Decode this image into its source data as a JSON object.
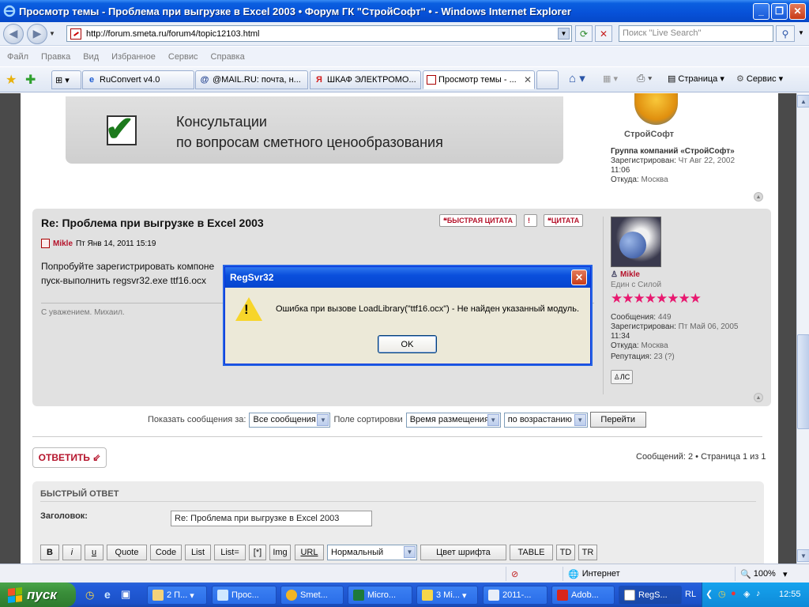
{
  "window": {
    "title": "Просмотр темы - Проблема при выгрузке в Excel 2003 • Форум ГК \"СтройСофт\" • - Windows Internet Explorer",
    "min": "_",
    "max": "❐",
    "close": "✕"
  },
  "address": {
    "url": "http://forum.smeta.ru/forum4/topic12103.html",
    "search_placeholder": "Поиск \"Live Search\""
  },
  "menu": [
    "Файл",
    "Правка",
    "Вид",
    "Избранное",
    "Сервис",
    "Справка"
  ],
  "tabs": [
    {
      "label": "RuConvert v4.0",
      "icon": "ie-icon"
    },
    {
      "label": "@MAIL.RU: почта, н...",
      "icon": "at-icon"
    },
    {
      "label": "ШКАФ ЭЛЕКТРОМО...",
      "icon": "yandex-icon"
    },
    {
      "label": "Просмотр темы - ...",
      "icon": "page-icon",
      "active": true
    }
  ],
  "commands": {
    "page": "Страница",
    "tools": "Сервис"
  },
  "banner": {
    "line1": "Консультации",
    "line2": "по вопросам сметного ценообразования"
  },
  "profile_top": {
    "brand": "СтройСофт",
    "group": "Группа компаний «СтройСофт»",
    "registered_label": "Зарегистрирован:",
    "registered_value": "Чт Авг 22, 2002",
    "registered_time": "11:06",
    "from_label": "Откуда:",
    "from_value": "Москва"
  },
  "post": {
    "title": "Re: Проблема при выгрузке в Excel 2003",
    "quick_quote": "❝БЫСТРАЯ ЦИТАТА",
    "report": "!",
    "quote": "❝ЦИТАТА",
    "author": "Mikle",
    "date": "Пт Янв 14, 2011 15:19",
    "body_line1": "Попробуйте зарегистрировать компоне",
    "body_line2": "пуск-выполнить regsvr32.exe ttf16.ocx",
    "signature": "С уважением. Михаил."
  },
  "profile_post": {
    "username": "Mikle",
    "rank": "Един с Силой",
    "stars": "★★★★★★★★",
    "posts_label": "Сообщения:",
    "posts_value": "449",
    "registered_label": "Зарегистрирован:",
    "registered_value": "Пт Май 06, 2005",
    "registered_time": "11:34",
    "from_label": "Откуда:",
    "from_value": "Москва",
    "rep_label": "Репутация:",
    "rep_value": "23 (?)",
    "pm": "ЛС"
  },
  "filter": {
    "show_label": "Показать сообщения за:",
    "show_value": "Все сообщения",
    "sort_label": "Поле сортировки",
    "sort_value": "Время размещения",
    "order_value": "по возрастанию",
    "go": "Перейти"
  },
  "reply_button": "ОТВЕТИТЬ ⇙",
  "page_info": "Сообщений: 2 • Страница 1 из 1",
  "quick_reply": {
    "title": "БЫСТРЫЙ ОТВЕТ",
    "subject_label": "Заголовок:",
    "subject_value": "Re: Проблема при выгрузке в Excel 2003",
    "toolbar": [
      "B",
      "i",
      "u",
      "Quote",
      "Code",
      "List",
      "List=",
      "[*]",
      "Img",
      "URL"
    ],
    "font_size": "Нормальный",
    "font_color": "Цвет шрифта",
    "table": "TABLE",
    "td": "TD",
    "tr": "TR"
  },
  "dialog": {
    "title": "RegSvr32",
    "message": "Ошибка при вызове LoadLibrary(\"ttf16.ocx\")  - Не найден указанный модуль.",
    "ok": "OK"
  },
  "status": {
    "zone": "Интернет",
    "zoom": "100%"
  },
  "taskbar": {
    "start": "пуск",
    "tasks": [
      {
        "label": "2 П...",
        "icon": "folder-icon"
      },
      {
        "label": "Прос...",
        "icon": "ie-icon"
      },
      {
        "label": "Smet...",
        "icon": "smeta-icon"
      },
      {
        "label": "Micro...",
        "icon": "excel-icon"
      },
      {
        "label": "3 Mi...",
        "icon": "app-icon"
      },
      {
        "label": "2011-...",
        "icon": "word-icon"
      },
      {
        "label": "Adob...",
        "icon": "acrobat-icon"
      },
      {
        "label": "RegS...",
        "icon": "window-icon",
        "active": true
      }
    ],
    "lang": "RL",
    "clock": "12:55"
  },
  "colors": {
    "accent": "#b5132b",
    "titlebar": "#0a5fe0",
    "taskbar": "#245edb"
  }
}
